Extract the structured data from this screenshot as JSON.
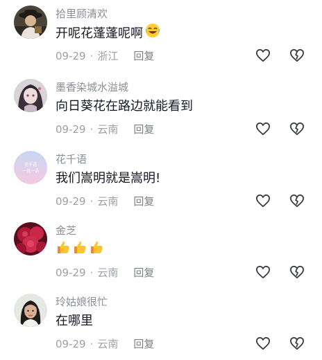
{
  "comments": [
    {
      "username": "拾里顾清欢",
      "text": "开呢花蓬蓬呢啊",
      "emoji": "laughing-crying-emoji",
      "date": "09-29",
      "location": "浙江",
      "reply_label": "回复",
      "avatar": "person-with-hat-avatar"
    },
    {
      "username": "墨香染城水溢城",
      "text": "向日葵花在路边就能看到",
      "date": "09-29",
      "location": "云南",
      "reply_label": "回复",
      "avatar": "anime-girl-avatar"
    },
    {
      "username": "花千语",
      "text": "我们嵩明就是嵩明!",
      "date": "09-29",
      "location": "云南",
      "reply_label": "回复",
      "avatar": "pastel-sky-avatar",
      "avatar_text": [
        "花千语",
        "一花一语"
      ]
    },
    {
      "username": "金芝",
      "text": "",
      "emoji": "thumbs-up-emoji",
      "emoji_count": 3,
      "date": "09-29",
      "location": "云南",
      "reply_label": "回复",
      "avatar": "red-rose-avatar"
    },
    {
      "username": "玲姑娘很忙",
      "text": "在哪里",
      "date": "09-29",
      "location": "云南",
      "reply_label": "回复",
      "avatar": "woman-portrait-avatar"
    }
  ],
  "dot_separator": "·",
  "colors": {
    "username": "#8a8f99",
    "text": "#161823",
    "meta": "#9ca0a8",
    "icon": "#3a3d45"
  }
}
